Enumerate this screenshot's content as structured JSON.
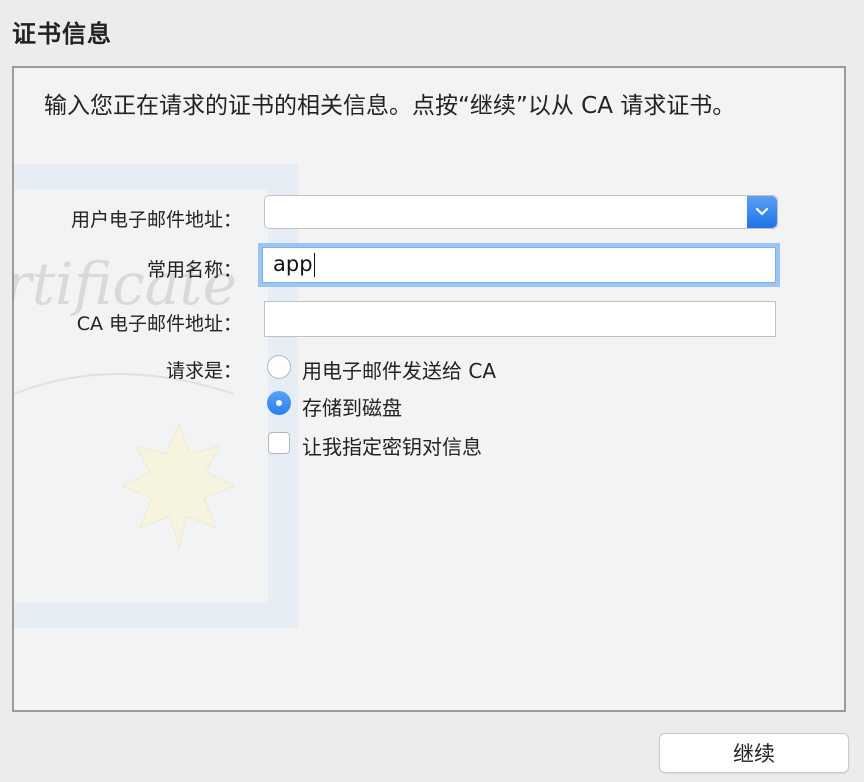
{
  "window": {
    "title": "证书信息"
  },
  "intro": "输入您正在请求的证书的相关信息。点按“继续”以从 CA 请求证书。",
  "form": {
    "user_email": {
      "label": "用户电子邮件地址：",
      "value": ""
    },
    "common_name": {
      "label": "常用名称：",
      "value": "app"
    },
    "ca_email": {
      "label": "CA 电子邮件地址：",
      "value": ""
    },
    "request": {
      "label": "请求是：",
      "options": [
        {
          "label": "用电子邮件发送给 CA",
          "selected": false
        },
        {
          "label": "存储到磁盘",
          "selected": true
        }
      ],
      "checkbox": {
        "label": "让我指定密钥对信息",
        "checked": false
      }
    }
  },
  "buttons": {
    "continue": "继续"
  },
  "colors": {
    "accent": "#2a7ff0",
    "focus_ring": "#9dc5f3",
    "background": "#ececec"
  },
  "icons": {
    "combo": "chevron-down-icon"
  }
}
